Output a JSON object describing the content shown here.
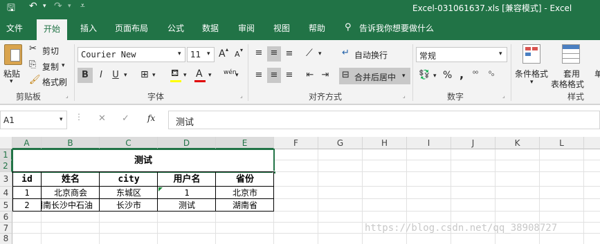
{
  "title_bar": {
    "quick_access_save": "save-icon",
    "title": "Excel-031061637.xls  [兼容模式]  -  Excel"
  },
  "tabs": [
    "文件",
    "开始",
    "插入",
    "页面布局",
    "公式",
    "数据",
    "审阅",
    "视图",
    "帮助"
  ],
  "tell_me": "告诉我你想要做什么",
  "clipboard": {
    "paste": "粘贴",
    "cut": "剪切",
    "copy": "复制",
    "format_painter": "格式刷",
    "group": "剪贴板"
  },
  "font": {
    "name": "Courier New",
    "size": "11",
    "bold": "B",
    "italic": "I",
    "underline": "U",
    "grow": "A",
    "shrink": "A",
    "group": "字体",
    "phonetic": "wén"
  },
  "alignment": {
    "wrap": "自动换行",
    "merge": "合并后居中",
    "group": "对齐方式"
  },
  "number": {
    "format": "常规",
    "percent": "%",
    "comma": ",",
    "group": "数字"
  },
  "styles": {
    "conditional": "条件格式",
    "table_format_1": "套用",
    "table_format_2": "表格格式",
    "cell_styles": "单",
    "group": "样式"
  },
  "formula_bar": {
    "name_box": "A1",
    "fx": "fx",
    "content": "测试"
  },
  "columns": [
    "A",
    "B",
    "C",
    "D",
    "E",
    "F",
    "G",
    "H",
    "I",
    "J",
    "K",
    "L"
  ],
  "rows": [
    "1",
    "2",
    "3",
    "4",
    "5",
    "6",
    "7",
    "8"
  ],
  "sheet": {
    "merged_title": "测试",
    "headers": [
      "id",
      "姓名",
      "city",
      "用户名",
      "省份"
    ],
    "rows": [
      [
        "1",
        "北京商会",
        "东城区",
        "1",
        "北京市"
      ],
      [
        "2",
        "湖南长沙中石油",
        "长沙市",
        "测试",
        "湖南省"
      ]
    ]
  },
  "watermark": "https://blog.csdn.net/qq_38908727",
  "colors": {
    "accent": "#217346",
    "ribbon": "#f3f3f3"
  }
}
